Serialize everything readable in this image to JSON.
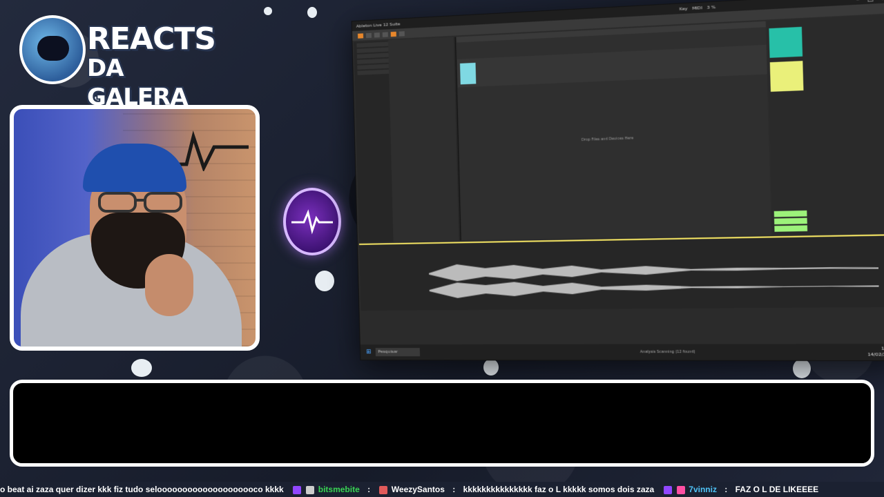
{
  "logo": {
    "line1": "REACTS",
    "line2": "DA GALERA"
  },
  "daw": {
    "title": "Ableton Live 12 Suite",
    "arrangement_hint": "Drop Files and Devices Here",
    "search_placeholder": "Pesquisar",
    "status_text": "Analysis Scanning (12 found)",
    "time": "17:44",
    "date": "14/02/2026",
    "key_label": "Key",
    "midi_label": "MIDI",
    "cpu_label": "3 %"
  },
  "ticker": {
    "messages": [
      {
        "user": "",
        "text": "o beat ai zaza  quer dizer kkk fiz tudo  seloooooooooooooooooooco  kkkk"
      },
      {
        "user": "bitsmebite",
        "text": ""
      },
      {
        "user": "WeezySantos",
        "text": "kkkkkkkkkkkkkkk  faz o L  kkkkk  somos dois zaza"
      },
      {
        "user": "7vinniz",
        "text": "FAZ O L DE LIKEEEE"
      }
    ],
    "colors": {
      "bitsmebite": "#39d353",
      "WeezySantos": "#ffffff",
      "7vinniz": "#4fc3f7"
    }
  }
}
